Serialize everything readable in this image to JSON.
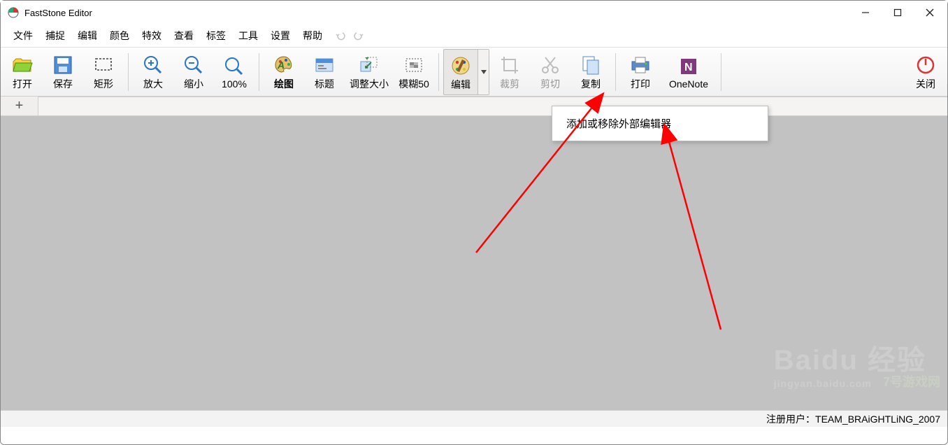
{
  "window": {
    "title": "FastStone Editor"
  },
  "menu": {
    "items": [
      "文件",
      "捕捉",
      "编辑",
      "颜色",
      "特效",
      "查看",
      "标签",
      "工具",
      "设置",
      "帮助"
    ]
  },
  "toolbar": {
    "open": "打开",
    "save": "保存",
    "rect": "矩形",
    "zoom_in": "放大",
    "zoom_out": "缩小",
    "zoom_100": "100%",
    "draw": "绘图",
    "caption": "标题",
    "resize": "调整大小",
    "blur": "模糊50",
    "edit": "编辑",
    "crop": "裁剪",
    "cut": "剪切",
    "copy": "复制",
    "print": "打印",
    "onenote": "OneNote",
    "close": "关闭"
  },
  "dropdown": {
    "item": "添加或移除外部编辑器"
  },
  "status": {
    "user_label": "注册用户：",
    "user_value": "TEAM_BRAiGHTLiNG_2007"
  },
  "watermark": {
    "main": "Baidu 经验",
    "sub": "jingyan.baidu.com",
    "side": "7号游戏网"
  },
  "icons": {
    "plus": "+"
  }
}
